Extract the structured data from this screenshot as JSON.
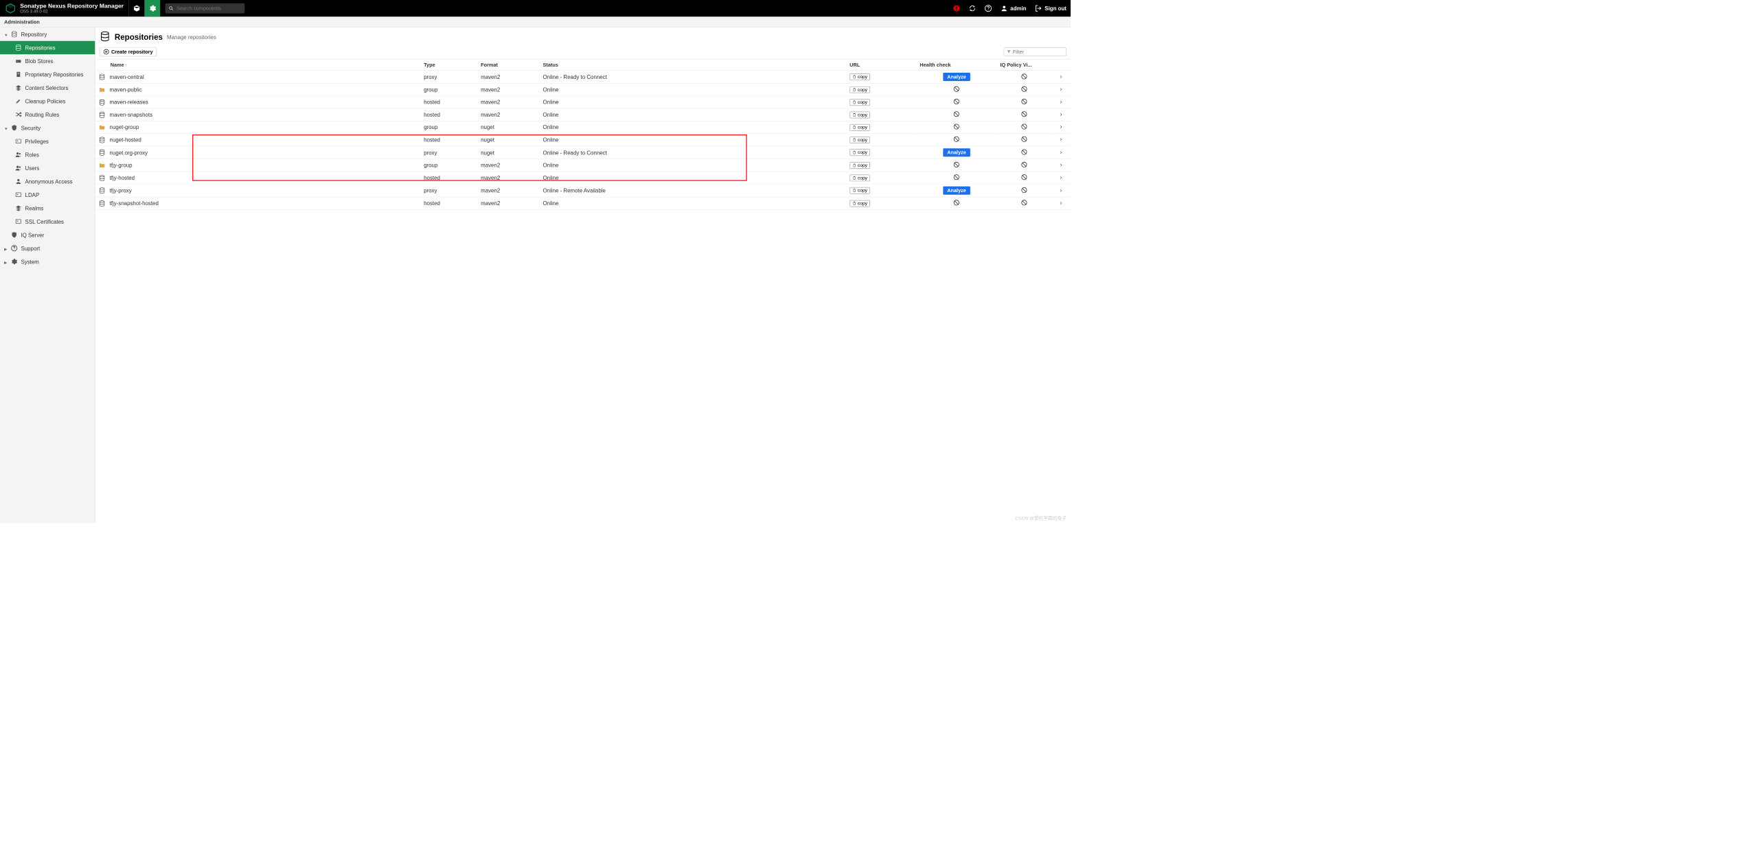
{
  "header": {
    "brand_title": "Sonatype Nexus Repository Manager",
    "brand_sub": "OSS 3.49.0-02",
    "search_placeholder": "Search components",
    "user_label": "admin",
    "signout_label": "Sign out"
  },
  "admin_strip": "Administration",
  "sidebar": {
    "repository": "Repository",
    "repositories": "Repositories",
    "blob_stores": "Blob Stores",
    "proprietary": "Proprietary Repositories",
    "content_selectors": "Content Selectors",
    "cleanup": "Cleanup Policies",
    "routing": "Routing Rules",
    "security": "Security",
    "privileges": "Privileges",
    "roles": "Roles",
    "users": "Users",
    "anonymous": "Anonymous Access",
    "ldap": "LDAP",
    "realms": "Realms",
    "ssl": "SSL Certificates",
    "iq_server": "IQ Server",
    "support": "Support",
    "system": "System"
  },
  "page": {
    "title": "Repositories",
    "subtitle": "Manage repositories",
    "create_btn": "Create repository",
    "filter_placeholder": "Filter"
  },
  "columns": {
    "name": "Name",
    "type": "Type",
    "format": "Format",
    "status": "Status",
    "url": "URL",
    "health": "Health check",
    "iq": "IQ Policy Vi..."
  },
  "copy_label": "copy",
  "analyze_label": "Analyze",
  "rows": [
    {
      "name": "maven-central",
      "type": "proxy",
      "format": "maven2",
      "status": "Online - Ready to Connect",
      "icon": "proxy",
      "health": "analyze"
    },
    {
      "name": "maven-public",
      "type": "group",
      "format": "maven2",
      "status": "Online",
      "icon": "group",
      "health": "ban"
    },
    {
      "name": "maven-releases",
      "type": "hosted",
      "format": "maven2",
      "status": "Online",
      "icon": "hosted",
      "health": "ban"
    },
    {
      "name": "maven-snapshots",
      "type": "hosted",
      "format": "maven2",
      "status": "Online",
      "icon": "hosted",
      "health": "ban"
    },
    {
      "name": "nuget-group",
      "type": "group",
      "format": "nuget",
      "status": "Online",
      "icon": "group",
      "health": "ban"
    },
    {
      "name": "nuget-hosted",
      "type": "hosted",
      "format": "nuget",
      "status": "Online",
      "icon": "hosted",
      "health": "ban"
    },
    {
      "name": "nuget.org-proxy",
      "type": "proxy",
      "format": "nuget",
      "status": "Online - Ready to Connect",
      "icon": "proxy",
      "health": "analyze"
    },
    {
      "name": "tfjy-group",
      "type": "group",
      "format": "maven2",
      "status": "Online",
      "icon": "group",
      "health": "ban"
    },
    {
      "name": "tfjy-hosted",
      "type": "hosted",
      "format": "maven2",
      "status": "Online",
      "icon": "hosted",
      "health": "ban"
    },
    {
      "name": "tfjy-proxy",
      "type": "proxy",
      "format": "maven2",
      "status": "Online - Remote Available",
      "icon": "proxy",
      "health": "analyze"
    },
    {
      "name": "tfjy-snapshot-hosted",
      "type": "hosted",
      "format": "maven2",
      "status": "Online",
      "icon": "hosted",
      "health": "ban"
    }
  ],
  "watermark": "CSDN @爱吃芋圆的兔子"
}
